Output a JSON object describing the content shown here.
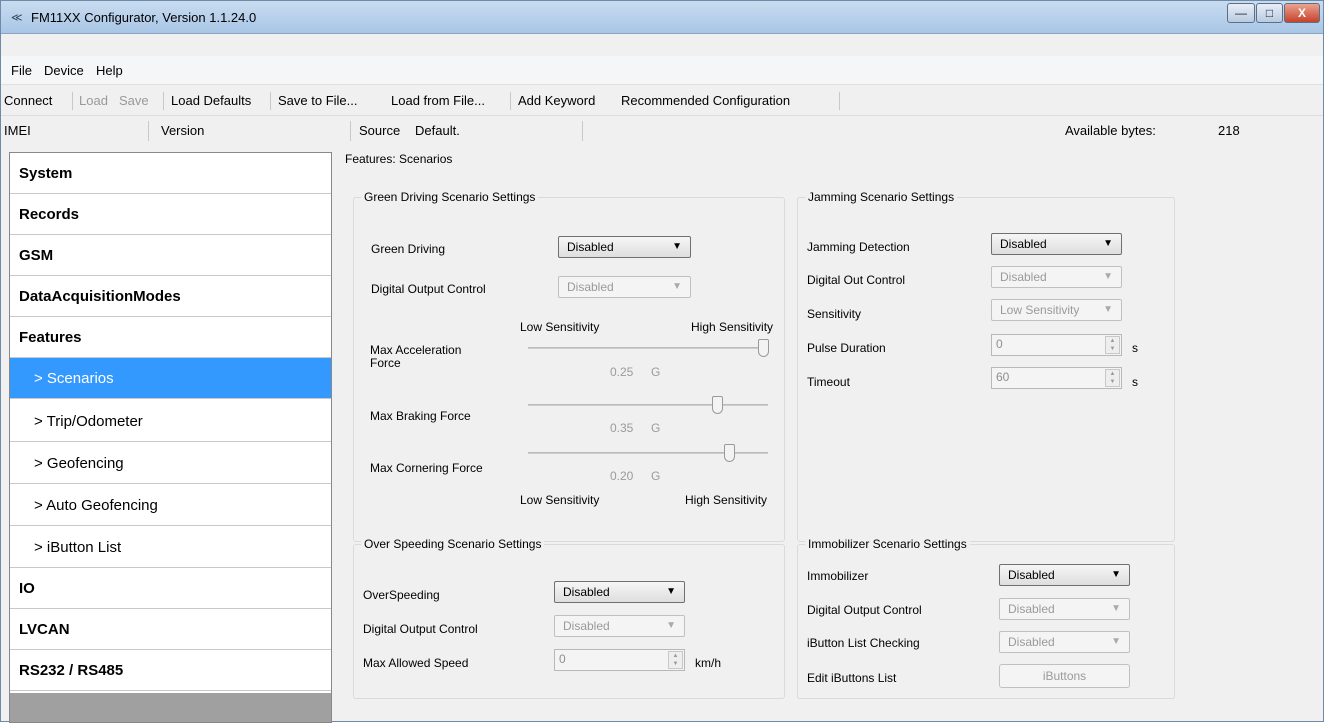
{
  "window": {
    "title": "FM11XX Configurator, Version 1.1.24.0",
    "min": "—",
    "max": "□",
    "close": "X"
  },
  "menu": [
    "File",
    "Device",
    "Help"
  ],
  "toolbar": {
    "connect": "Connect",
    "load": "Load",
    "save": "Save",
    "load_defaults": "Load Defaults",
    "save_to_file": "Save to File...",
    "load_from_file": "Load from File...",
    "add_keyword": "Add Keyword",
    "recommended": "Recommended Configuration"
  },
  "info": {
    "imei_label": "IMEI",
    "version_label": "Version",
    "source_label": "Source",
    "source_value": "Default.",
    "available_label": "Available bytes:",
    "available_value": "218"
  },
  "sidebar": [
    {
      "label": "System"
    },
    {
      "label": "Records"
    },
    {
      "label": "GSM"
    },
    {
      "label": "DataAcquisitionModes"
    },
    {
      "label": "Features"
    },
    {
      "label": "> Scenarios"
    },
    {
      "label": "> Trip/Odometer"
    },
    {
      "label": "> Geofencing"
    },
    {
      "label": "> Auto Geofencing"
    },
    {
      "label": "> iButton List"
    },
    {
      "label": "IO"
    },
    {
      "label": "LVCAN"
    },
    {
      "label": "RS232 / RS485"
    }
  ],
  "content": {
    "header": "Features: Scenarios"
  },
  "green": {
    "title": "Green Driving Scenario Settings",
    "gd_label": "Green Driving",
    "gd_value": "Disabled",
    "doc_label": "Digital Output Control",
    "doc_value": "Disabled",
    "low": "Low Sensitivity",
    "high": "High Sensitivity",
    "acc_label": "Max Acceleration Force",
    "acc_value": "0.25",
    "acc_unit": "G",
    "acc_level": 1.0,
    "brk_label": "Max Braking Force",
    "brk_value": "0.35",
    "brk_unit": "G",
    "brk_level": 0.8,
    "cor_label": "Max Cornering Force",
    "cor_value": "0.20",
    "cor_unit": "G",
    "cor_level": 0.85,
    "low2": "Low Sensitivity",
    "high2": "High Sensitivity"
  },
  "jamming": {
    "title": "Jamming Scenario Settings",
    "jd_label": "Jamming Detection",
    "jd_value": "Disabled",
    "doc_label": "Digital Out Control",
    "doc_value": "Disabled",
    "sens_label": "Sensitivity",
    "sens_value": "Low Sensitivity",
    "pulse_label": "Pulse Duration",
    "pulse_value": "0",
    "pulse_unit": "s",
    "timeout_label": "Timeout",
    "timeout_value": "60",
    "timeout_unit": "s"
  },
  "overspeed": {
    "title": "Over Speeding Scenario Settings",
    "os_label": "OverSpeeding",
    "os_value": "Disabled",
    "doc_label": "Digital Output Control",
    "doc_value": "Disabled",
    "max_label": "Max Allowed Speed",
    "max_value": "0",
    "max_unit": "km/h"
  },
  "immobilizer": {
    "title": "Immobilizer Scenario Settings",
    "im_label": "Immobilizer",
    "im_value": "Disabled",
    "doc_label": "Digital Output Control",
    "doc_value": "Disabled",
    "ib_label": "iButton List Checking",
    "ib_value": "Disabled",
    "edit_label": "Edit iButtons List",
    "edit_button": "iButtons"
  },
  "glyphs": {
    "arrow": "▼",
    "up": "▲",
    "down": "▼"
  }
}
